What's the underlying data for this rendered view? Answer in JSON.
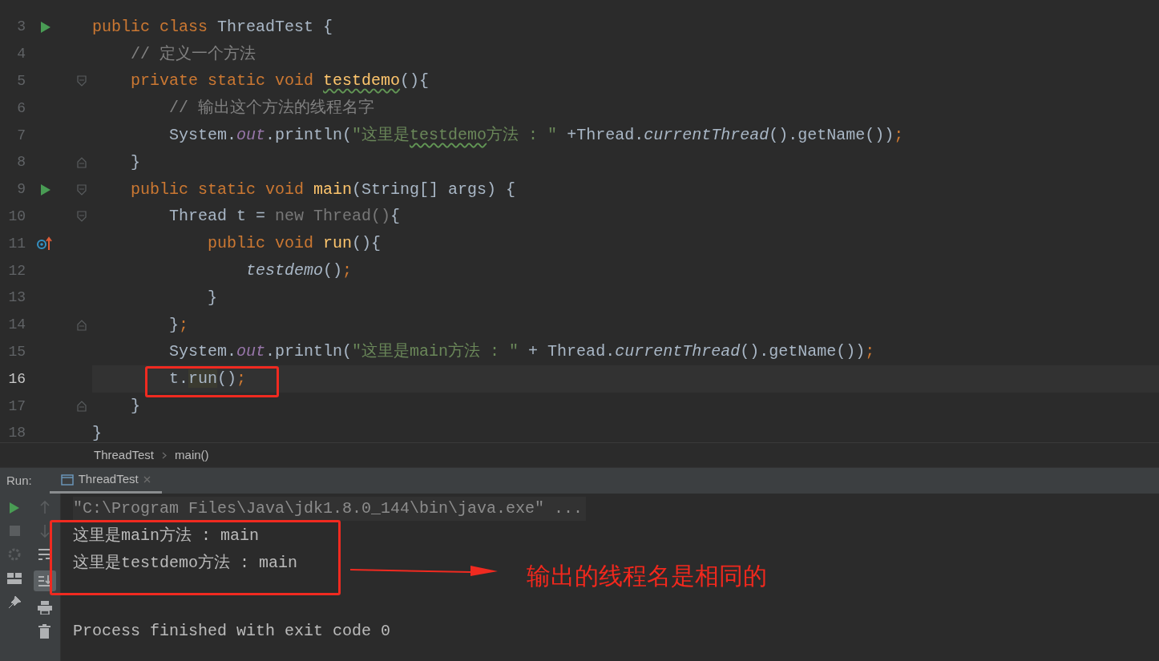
{
  "editor": {
    "lines": [
      {
        "number": "3",
        "run": true,
        "tokens": [
          {
            "text": "public class ",
            "kind": "kw"
          },
          {
            "text": "ThreadTest {",
            "kind": "plain"
          }
        ]
      },
      {
        "number": "4",
        "tokens": [
          {
            "text": "    // 定义一个方法",
            "kind": "comment"
          }
        ]
      },
      {
        "number": "5",
        "fold_start": true,
        "tokens": [
          {
            "text": "    private static void ",
            "kind": "kw"
          },
          {
            "text": "testdemo",
            "kind": "decl",
            "underline": true
          },
          {
            "text": "(){",
            "kind": "plain"
          }
        ]
      },
      {
        "number": "6",
        "tokens": [
          {
            "text": "        // 输出这个方法的线程名字",
            "kind": "comment"
          }
        ]
      },
      {
        "number": "7",
        "tokens": [
          {
            "text": "        System.",
            "kind": "plain"
          },
          {
            "text": "out",
            "kind": "field"
          },
          {
            "text": ".println(",
            "kind": "plain"
          },
          {
            "text": "\"这里是",
            "kind": "string"
          },
          {
            "text": "testdemo",
            "kind": "string",
            "underline": true
          },
          {
            "text": "方法 : \" ",
            "kind": "string"
          },
          {
            "text": "+Thread.",
            "kind": "plain"
          },
          {
            "text": "currentThread",
            "kind": "static_call"
          },
          {
            "text": "().getName())",
            "kind": "plain"
          },
          {
            "text": ";",
            "kind": "semi"
          }
        ]
      },
      {
        "number": "8",
        "fold_end": true,
        "tokens": [
          {
            "text": "    }",
            "kind": "plain"
          }
        ]
      },
      {
        "number": "9",
        "run": true,
        "fold_start": true,
        "tokens": [
          {
            "text": "    public static void ",
            "kind": "kw"
          },
          {
            "text": "main",
            "kind": "decl"
          },
          {
            "text": "(String[] args) {",
            "kind": "plain"
          }
        ]
      },
      {
        "number": "10",
        "fold_start": true,
        "tokens": [
          {
            "text": "        Thread t = ",
            "kind": "plain"
          },
          {
            "text": "new Thread()",
            "kind": "dim"
          },
          {
            "text": "{",
            "kind": "plain"
          }
        ]
      },
      {
        "number": "11",
        "override": true,
        "tokens": [
          {
            "text": "            public void ",
            "kind": "kw"
          },
          {
            "text": "run",
            "kind": "decl"
          },
          {
            "text": "(){",
            "kind": "plain"
          }
        ]
      },
      {
        "number": "12",
        "tokens": [
          {
            "text": "                testdemo",
            "kind": "static_call"
          },
          {
            "text": "()",
            "kind": "plain"
          },
          {
            "text": ";",
            "kind": "semi"
          }
        ]
      },
      {
        "number": "13",
        "tokens": [
          {
            "text": "            }",
            "kind": "plain"
          }
        ]
      },
      {
        "number": "14",
        "fold_end": true,
        "tokens": [
          {
            "text": "        }",
            "kind": "plain"
          },
          {
            "text": ";",
            "kind": "semi"
          }
        ]
      },
      {
        "number": "15",
        "tokens": [
          {
            "text": "        System.",
            "kind": "plain"
          },
          {
            "text": "out",
            "kind": "field"
          },
          {
            "text": ".println(",
            "kind": "plain"
          },
          {
            "text": "\"这里是main方法 : \"",
            "kind": "string"
          },
          {
            "text": " + Thread.",
            "kind": "plain"
          },
          {
            "text": "currentThread",
            "kind": "static_call"
          },
          {
            "text": "().getName())",
            "kind": "plain"
          },
          {
            "text": ";",
            "kind": "semi"
          }
        ]
      },
      {
        "number": "16",
        "current": true,
        "boxed": true,
        "tokens": [
          {
            "text": "        t.",
            "kind": "plain"
          },
          {
            "text": "run",
            "kind": "plain",
            "highlighted": true
          },
          {
            "text": "()",
            "kind": "plain"
          },
          {
            "text": ";",
            "kind": "semi"
          }
        ]
      },
      {
        "number": "17",
        "fold_end": true,
        "tokens": [
          {
            "text": "    }",
            "kind": "plain"
          }
        ]
      },
      {
        "number": "18",
        "tokens": [
          {
            "text": "}",
            "kind": "plain"
          }
        ]
      }
    ]
  },
  "breadcrumbs": [
    "ThreadTest",
    "main()"
  ],
  "run_panel": {
    "label": "Run:",
    "tabs": [
      {
        "label": "ThreadTest",
        "selected": true
      }
    ],
    "scroll_to_end_on": true,
    "console": [
      {
        "kind": "command",
        "text": "\"C:\\Program Files\\Java\\jdk1.8.0_144\\bin\\java.exe\" ..."
      },
      {
        "kind": "output",
        "text": "这里是main方法 : main"
      },
      {
        "kind": "output",
        "text": "这里是testdemo方法 : main"
      },
      {
        "kind": "exit",
        "text": "Process finished with exit code 0"
      }
    ]
  },
  "annotation": {
    "text": "输出的线程名是相同的"
  }
}
